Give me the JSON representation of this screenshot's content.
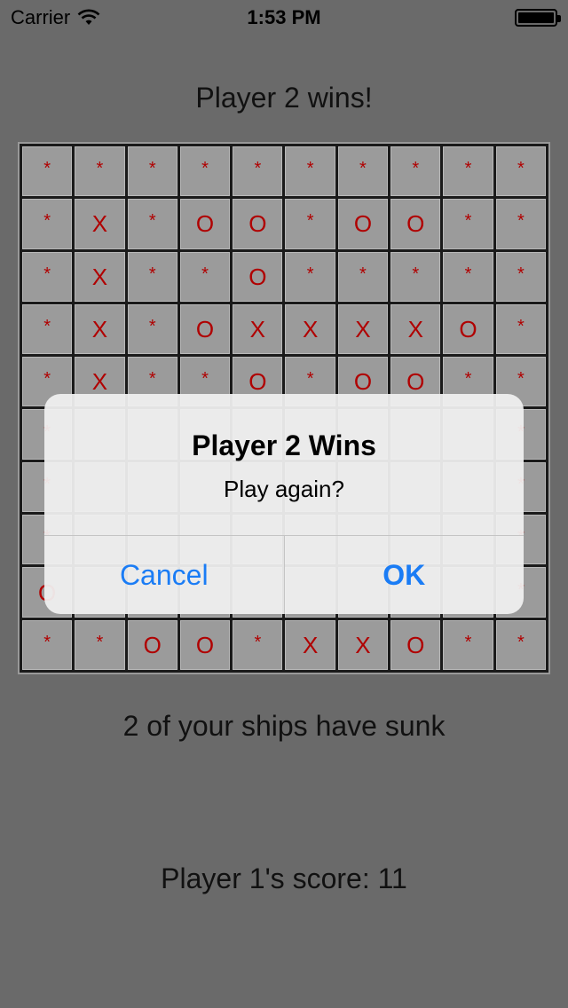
{
  "status_bar": {
    "carrier": "Carrier",
    "time": "1:53 PM",
    "wifi_icon": "wifi-icon",
    "battery_icon": "battery-icon",
    "battery_level": 1.0
  },
  "game": {
    "headline": "Player 2 wins!",
    "board": [
      [
        "*",
        "*",
        "*",
        "*",
        "*",
        "*",
        "*",
        "*",
        "*",
        "*"
      ],
      [
        "*",
        "X",
        "*",
        "O",
        "O",
        "*",
        "O",
        "O",
        "*",
        "*"
      ],
      [
        "*",
        "X",
        "*",
        "*",
        "O",
        "*",
        "*",
        "*",
        "*",
        "*"
      ],
      [
        "*",
        "X",
        "*",
        "O",
        "X",
        "X",
        "X",
        "X",
        "O",
        "*"
      ],
      [
        "*",
        "X",
        "*",
        "*",
        "O",
        "*",
        "O",
        "O",
        "*",
        "*"
      ],
      [
        "*",
        "",
        "",
        "",
        "",
        "",
        "",
        "",
        "",
        "*"
      ],
      [
        "*",
        "",
        "",
        "",
        "",
        "",
        "",
        "",
        "",
        "*"
      ],
      [
        "*",
        "",
        "",
        "",
        "",
        "",
        "",
        "",
        "",
        "*"
      ],
      [
        "O",
        "",
        "",
        "",
        "",
        "",
        "",
        "",
        "",
        "*"
      ],
      [
        "*",
        "*",
        "O",
        "O",
        "*",
        "X",
        "X",
        "O",
        "*",
        "*"
      ]
    ],
    "ships_status": "2 of your ships have sunk",
    "score_text": "Player 1's score: 11"
  },
  "alert": {
    "title": "Player 2 Wins",
    "message": "Play again?",
    "cancel_label": "Cancel",
    "ok_label": "OK"
  },
  "colors": {
    "background": "#6a6a6a",
    "cell_background": "#9b9b9b",
    "mark_color": "#b00000",
    "alert_button_color": "#1a7cf5"
  }
}
